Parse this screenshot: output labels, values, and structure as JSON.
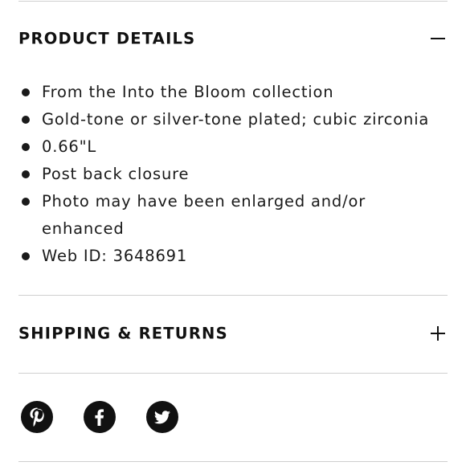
{
  "product_details": {
    "title": "PRODUCT DETAILS",
    "toggle_icon": "minus-icon",
    "items": [
      "From the Into the Bloom collection",
      "Gold-tone or silver-tone plated; cubic zirconia",
      "0.66\"L",
      "Post back closure",
      "Photo may have been enlarged and/or enhanced",
      "Web ID: 3648691"
    ]
  },
  "shipping_returns": {
    "title": "SHIPPING & RETURNS",
    "toggle_icon": "plus-icon"
  },
  "social": {
    "icons": [
      "pinterest-icon",
      "facebook-icon",
      "twitter-icon"
    ]
  },
  "colors": {
    "text": "#1a1a1a",
    "icon_bg": "#111111",
    "divider": "#cfcfcf"
  }
}
